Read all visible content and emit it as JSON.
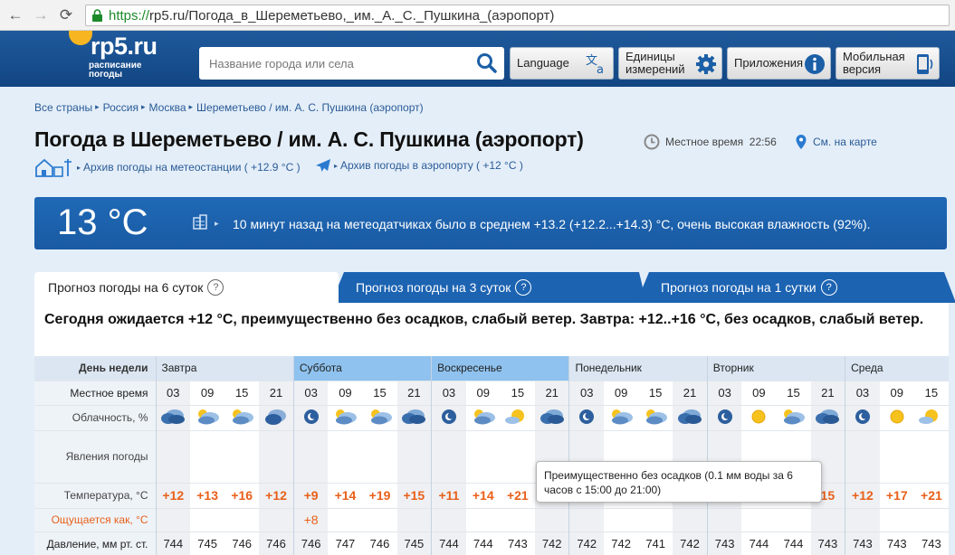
{
  "browser": {
    "url_scheme": "https://",
    "url_rest": "rp5.ru/Погода_в_Шереметьево,_им._А._С._Пушкина_(аэропорт)"
  },
  "header": {
    "logo_text": "rp5.ru",
    "logo_sub_1": "расписание",
    "logo_sub_2": "погоды",
    "search_placeholder": "Название города или села",
    "buttons": {
      "language": "Language",
      "units_1": "Единицы",
      "units_2": "измерений",
      "apps": "Приложения",
      "mobile_1": "Мобильная",
      "mobile_2": "версия"
    }
  },
  "breadcrumb": [
    "Все страны",
    "Россия",
    "Москва",
    "Шереметьево / им. А. С. Пушкина (аэропорт)"
  ],
  "page": {
    "title": "Погода в Шереметьево / им. А. С. Пушкина (аэропорт)",
    "local_time_label": "Местное время",
    "local_time": "22:56",
    "map_link": "См. на карте",
    "archive_station": "Архив погоды на метеостанции ( +12.9 °C )",
    "archive_airport": "Архив погоды в аэропорту ( +12 °C )"
  },
  "now": {
    "temp": "13 °C",
    "text": "10 минут назад на метеодатчиках было в среднем +13.2 (+12.2...+14.3) °C, очень высокая влажность (92%)."
  },
  "tabs": {
    "six": "Прогноз погоды на 6 суток",
    "three": "Прогноз погоды на 3 суток",
    "one": "Прогноз погоды на 1 сутки",
    "help": "?"
  },
  "summary": "Сегодня ожидается +12 °C, преимущественно без осадков, слабый ветер. Завтра: +12..+16 °C, без осадков, слабый ветер.",
  "table": {
    "row_labels": {
      "day": "День недели",
      "time": "Местное время",
      "cloud": "Облачность, %",
      "phen": "Явления погоды",
      "temp": "Температура, °C",
      "feel": "Ощущается как, °C",
      "pres": "Давление, мм рт. ст."
    },
    "days": [
      "Завтра",
      "Суббота",
      "Воскресенье",
      "Понедельник",
      "Вторник",
      "Среда"
    ],
    "times": [
      "03",
      "09",
      "15",
      "21",
      "03",
      "09",
      "15",
      "21",
      "03",
      "09",
      "15",
      "21",
      "03",
      "09",
      "15",
      "21",
      "03",
      "09",
      "15",
      "21",
      "03",
      "09",
      "15"
    ],
    "clouds": [
      "cloud",
      "partly",
      "partly",
      "cloud-night",
      "clear-night",
      "partly",
      "partly",
      "cloud",
      "clear-night",
      "partly",
      "sun-cloud",
      "cloud",
      "clear-night",
      "partly",
      "partly",
      "cloud",
      "clear-night",
      "sun",
      "partly",
      "cloud",
      "clear-night",
      "sun",
      "sun-cloud"
    ],
    "temps": [
      "+12",
      "+13",
      "+16",
      "+12",
      "+9",
      "+14",
      "+19",
      "+15",
      "+11",
      "+14",
      "+21",
      "",
      "",
      "",
      "",
      "",
      "",
      "",
      "",
      "15",
      "+12",
      "+17",
      "+21"
    ],
    "feels": [
      "",
      "",
      "",
      "",
      "+8",
      "",
      "",
      "",
      "",
      "",
      "",
      "",
      "",
      "",
      "",
      "",
      "",
      "",
      "",
      "",
      "",
      "",
      ""
    ],
    "pressures": [
      "744",
      "745",
      "746",
      "746",
      "746",
      "747",
      "746",
      "745",
      "744",
      "744",
      "743",
      "742",
      "742",
      "742",
      "741",
      "742",
      "743",
      "744",
      "744",
      "743",
      "743",
      "743",
      "743"
    ]
  },
  "tooltip": "Преимущественно без осадков (0.1 мм воды за 6 часов с 15:00 до 21:00)"
}
